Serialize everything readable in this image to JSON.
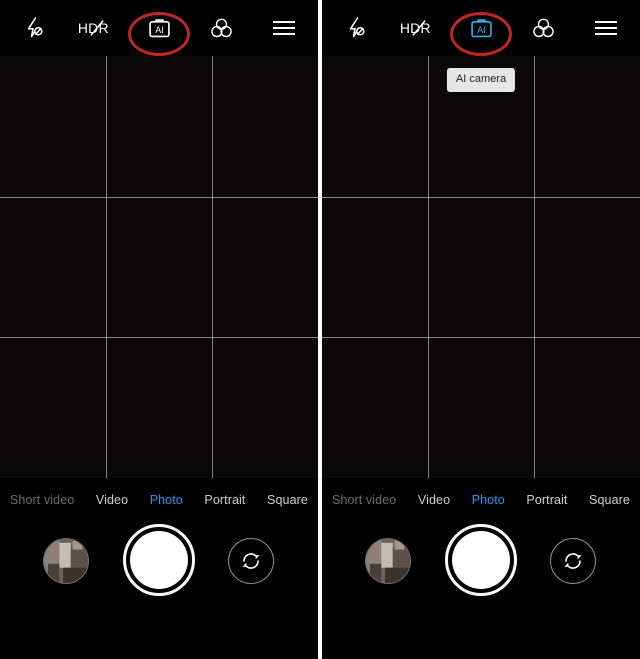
{
  "app": {
    "name": "Camera",
    "screens": [
      {
        "id": "left",
        "annotation_ring": true,
        "tooltip_visible": false,
        "tooltip_text": "",
        "ai_active": false
      },
      {
        "id": "right",
        "annotation_ring": true,
        "tooltip_visible": true,
        "tooltip_text": "AI camera",
        "ai_active": true
      }
    ]
  },
  "toolbar": {
    "flash_label": "Flash off",
    "hdr_label": "HDR off",
    "ai_label": "AI camera",
    "filters_label": "Filters",
    "menu_label": "More settings"
  },
  "modes": [
    {
      "label": "Short video",
      "state": "dim"
    },
    {
      "label": "Video",
      "state": "normal"
    },
    {
      "label": "Photo",
      "state": "active"
    },
    {
      "label": "Portrait",
      "state": "normal"
    },
    {
      "label": "Square",
      "state": "normal"
    }
  ],
  "controls": {
    "gallery_label": "Gallery thumbnail",
    "shutter_label": "Shutter",
    "flip_label": "Switch camera"
  },
  "viewfinder": {
    "grid": "3x3",
    "preview_state": "dark"
  },
  "colors": {
    "accent_active": "#2196f3",
    "annotation": "#c02626",
    "ai_active": "#29b6f6",
    "tooltip_bg": "#e6e6e6",
    "tooltip_text": "#1f1f1f",
    "grid_line": "#d4d0cd",
    "background": "#000000"
  },
  "icons": {
    "flash": "flash-off-icon",
    "hdr": "hdr-off-icon",
    "ai": "ai-camera-icon",
    "filters": "filters-icon",
    "menu": "hamburger-menu-icon",
    "flip": "camera-flip-icon"
  }
}
